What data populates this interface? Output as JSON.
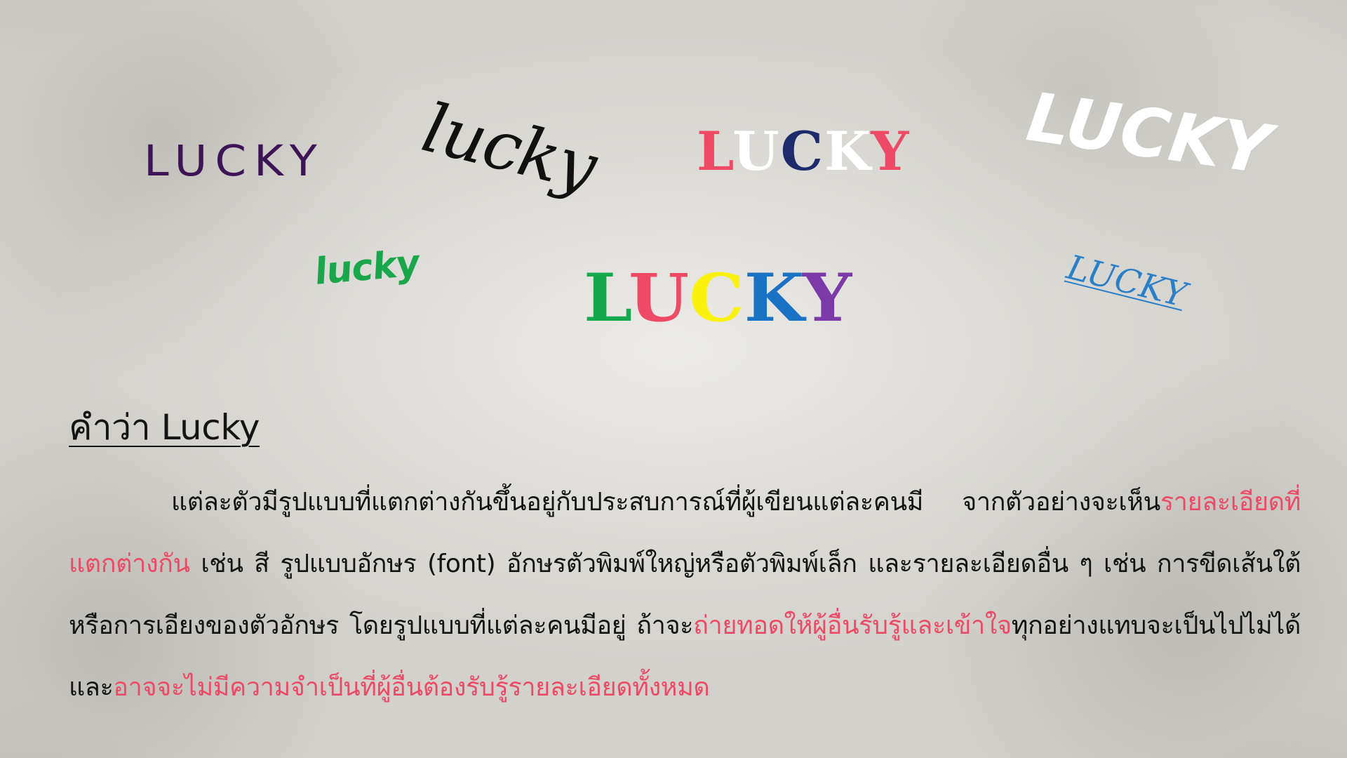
{
  "words": [
    {
      "text": "LUCKY"
    },
    {
      "text": "lucky"
    },
    {
      "letters": [
        {
          "ch": "L",
          "color": "#ee4a65"
        },
        {
          "ch": "U",
          "color": "#ffffff"
        },
        {
          "ch": "C",
          "color": "#1d2a6b"
        },
        {
          "ch": "K",
          "color": "#ffffff"
        },
        {
          "ch": "Y",
          "color": "#ee4a65"
        }
      ]
    },
    {
      "text": "LUCKY"
    },
    {
      "text": "lucky"
    },
    {
      "letters": [
        {
          "ch": "L",
          "color": "#15a94d"
        },
        {
          "ch": "U",
          "color": "#ee4a65"
        },
        {
          "ch": "C",
          "color": "#fbf20c"
        },
        {
          "ch": "K",
          "color": "#1a72c4"
        },
        {
          "ch": "Y",
          "color": "#7b3aa8"
        }
      ]
    },
    {
      "text": "LUCKY"
    }
  ],
  "heading": "คำว่า Lucky",
  "paragraph": [
    {
      "text": "แต่ละตัวมีรูปแบบที่แตกต่างกันขึ้นอยู่กับประสบการณ์ที่ผู้เขียนแต่ละคนมี จากตัวอย่างจะเห็น",
      "highlight": false
    },
    {
      "text": "รายละเอียดที่แตกต่างกัน",
      "highlight": true
    },
    {
      "text": " เช่น สี รูปแบบอักษร (font) อักษรตัวพิมพ์ใหญ่หรือตัวพิมพ์เล็ก และรายละเอียดอื่น ๆ เช่น การขีดเส้นใต้ หรือการเอียงของตัวอักษร โดยรูปแบบที่แต่ละคนมีอยู่ ถ้าจะ",
      "highlight": false
    },
    {
      "text": "ถ่ายทอดให้ผู้อื่นรับรู้และเข้าใจ",
      "highlight": true
    },
    {
      "text": "ทุกอย่างแทบจะเป็นไปไม่ได้ และ",
      "highlight": false
    },
    {
      "text": "อาจจะไม่มีความจำเป็นที่ผู้อื่นต้องรับรู้รายละเอียดทั้งหมด",
      "highlight": true
    }
  ],
  "colors": {
    "highlight": "#ee4a65",
    "text": "#141414",
    "background": "#d3d1cc"
  }
}
